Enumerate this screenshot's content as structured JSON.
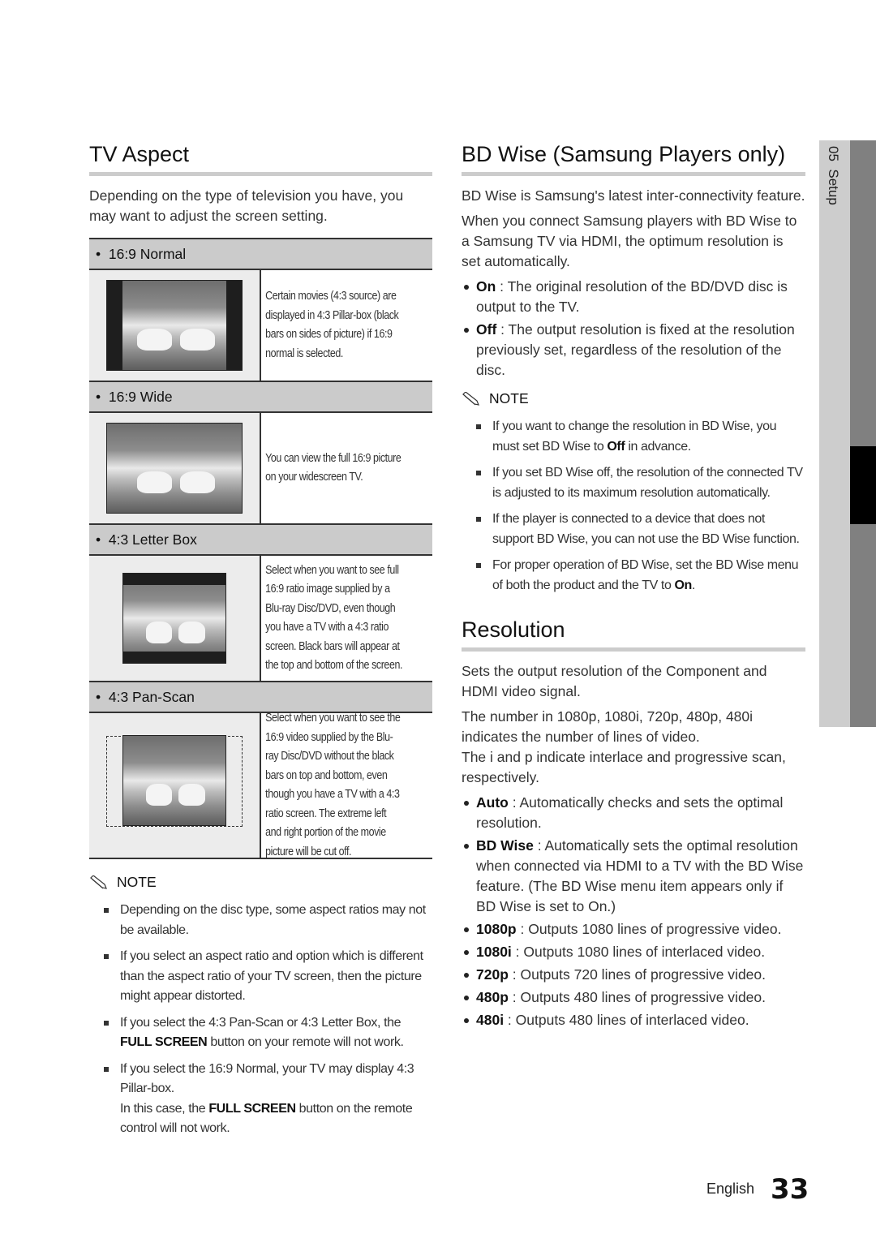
{
  "tv_aspect": {
    "title": "TV Aspect",
    "intro": "Depending on the type of television you have, you may want to adjust the screen setting.",
    "options": [
      {
        "label": "16:9 Normal",
        "description": "Certain movies (4:3 source) are displayed in 4:3 Pillar-box (black bars on sides of picture) if 16:9 normal is selected.",
        "image": "pillarbox-puppies-image"
      },
      {
        "label": "16:9 Wide",
        "description": "You can view the full 16:9 picture on your widescreen TV.",
        "image": "wide-puppies-image"
      },
      {
        "label": "4:3 Letter Box",
        "description": "Select when you want to see full 16:9 ratio image supplied by a Blu-ray Disc/DVD, even though you have a TV with a 4:3 ratio screen. Black bars will appear at the top and bottom of the screen.",
        "image": "letterbox-puppies-image"
      },
      {
        "label": "4:3 Pan-Scan",
        "description": "Select when you want to see the 16:9 video supplied by the Blu-ray Disc/DVD without the black bars on top and bottom, even though you have a TV with a 4:3 ratio screen. The extreme left and right portion of the movie picture will be cut off.",
        "image": "panscan-puppies-image"
      }
    ],
    "note_label": "NOTE",
    "notes": [
      {
        "text": "Depending on the disc type, some aspect ratios may not be available."
      },
      {
        "text": "If you select an aspect ratio and option which is different than the aspect ratio of your TV screen, then the picture might appear distorted."
      },
      {
        "pre": "If you select the 4:3 Pan-Scan or 4:3 Letter Box, the ",
        "bold": "FULL SCREEN",
        "post": " button on your remote will not work."
      },
      {
        "text": "If you select the 16:9 Normal, your TV may display 4:3 Pillar-box.",
        "pre2": "In this case, the ",
        "bold2": "FULL SCREEN",
        "post2": " button on the remote control will not work."
      }
    ]
  },
  "bd_wise": {
    "title": "BD Wise (Samsung Players only)",
    "paragraphs": [
      "BD Wise is Samsung's latest inter-connectivity feature.",
      "When you connect Samsung players with BD Wise to a Samsung TV via HDMI, the optimum resolution is set automatically."
    ],
    "items": [
      {
        "term": "On",
        "desc": " : The original resolution of the BD/DVD disc is output to the TV."
      },
      {
        "term": "Off",
        "desc": " : The output resolution is fixed at the resolution previously set, regardless of the resolution of the disc."
      }
    ],
    "note_label": "NOTE",
    "notes": [
      {
        "pre": "If you want to change the resolution in BD Wise, you must set BD Wise to ",
        "bold": "Off",
        "post": " in advance."
      },
      {
        "pre": "If you set BD Wise off, the resolution of the connected TV is adjusted to its maximum resolution automatically.",
        "bold": "",
        "post": ""
      },
      {
        "pre": "If the player is connected to a device that does not support BD Wise, you can not use the BD Wise function.",
        "bold": "",
        "post": ""
      },
      {
        "pre": "For proper operation of BD Wise, set the BD Wise menu of both the product and the TV to ",
        "bold": "On",
        "post": "."
      }
    ]
  },
  "resolution": {
    "title": "Resolution",
    "paragraphs": [
      "Sets the output resolution of the Component and HDMI video signal.",
      "The number in 1080p, 1080i, 720p, 480p, 480i indicates the number of lines of video.",
      "The i and p indicate interlace and progressive scan, respectively."
    ],
    "items": [
      {
        "term": "Auto",
        "desc": " : Automatically checks and sets the optimal resolution."
      },
      {
        "term": "BD Wise",
        "desc": " : Automatically sets the optimal resolution when connected via HDMI to a TV with the BD Wise feature. (The BD Wise menu item appears only if BD Wise is set to On.)"
      },
      {
        "term": "1080p",
        "desc": " : Outputs 1080 lines of progressive video."
      },
      {
        "term": "1080i",
        "desc": " : Outputs 1080 lines of interlaced video."
      },
      {
        "term": "720p",
        "desc": " : Outputs 720 lines of progressive video."
      },
      {
        "term": "480p",
        "desc": " : Outputs 480 lines of progressive video."
      },
      {
        "term": "480i",
        "desc": " : Outputs 480 lines of interlaced video."
      }
    ]
  },
  "side_tab": {
    "chapter": "05",
    "label": "Setup"
  },
  "footer": {
    "language": "English",
    "page_number": "33"
  }
}
